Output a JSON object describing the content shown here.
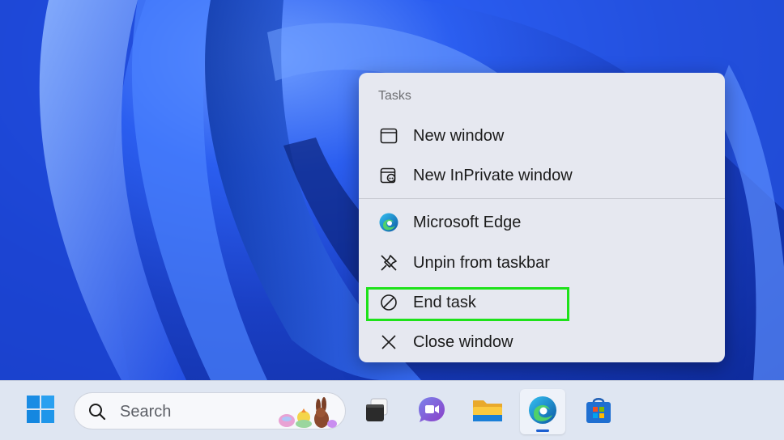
{
  "jump_list": {
    "section_title": "Tasks",
    "items": [
      {
        "label": "New window",
        "icon": "window-icon"
      },
      {
        "label": "New InPrivate window",
        "icon": "inprivate-window-icon"
      },
      {
        "label": "Microsoft Edge",
        "icon": "edge-icon"
      },
      {
        "label": "Unpin from taskbar",
        "icon": "unpin-icon"
      },
      {
        "label": "End task",
        "icon": "prohibited-icon"
      },
      {
        "label": "Close window",
        "icon": "close-icon"
      }
    ]
  },
  "taskbar": {
    "search_placeholder": "Search",
    "apps": [
      "task-view-icon",
      "teams-chat-icon",
      "file-explorer-icon",
      "edge-icon",
      "microsoft-store-icon"
    ],
    "active_app": "edge-icon"
  },
  "colors": {
    "highlight": "#1ee21a",
    "accent": "#1c5fd1",
    "wallpaper": "#2b5ef0"
  }
}
